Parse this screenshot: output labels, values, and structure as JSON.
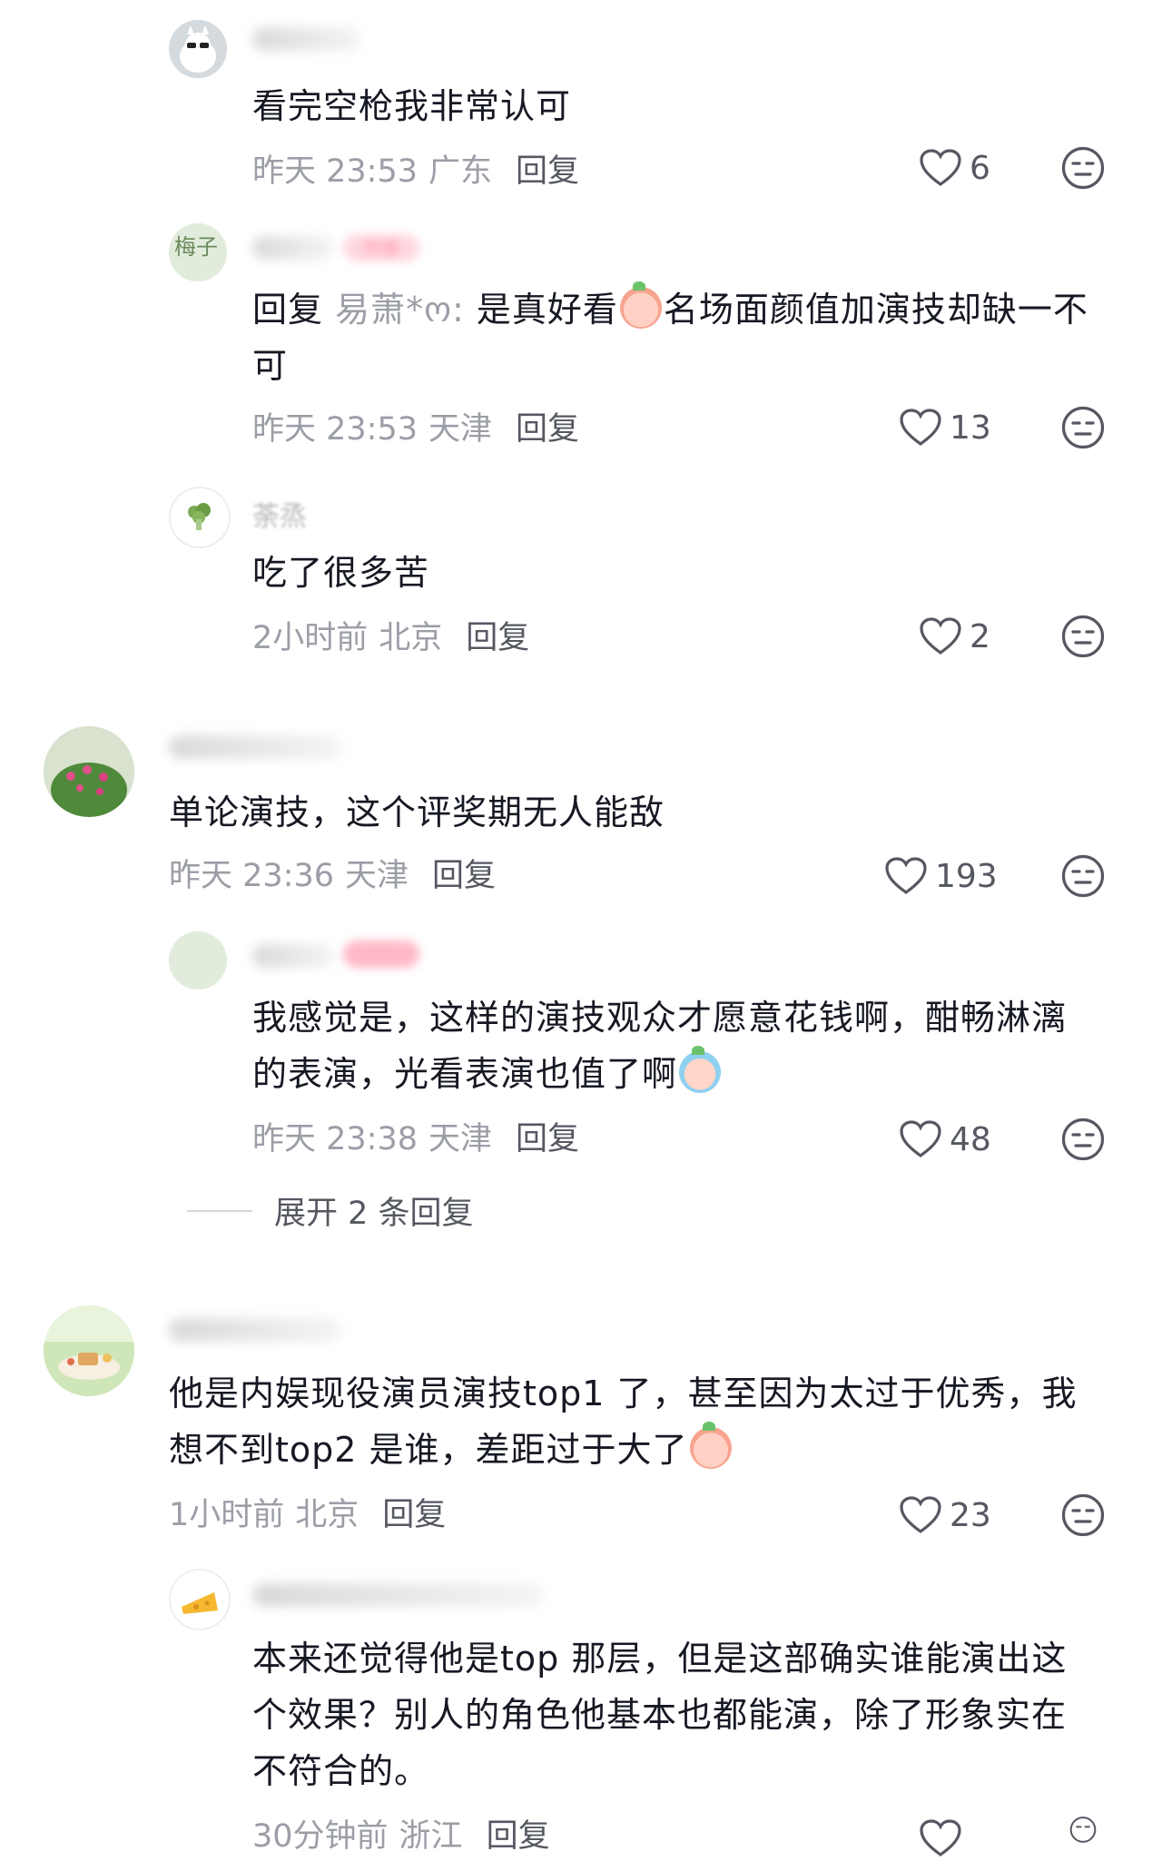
{
  "comments": [
    {
      "text": "看完空枪我非常认可",
      "time": "昨天 23:53",
      "location": "广东",
      "reply_label": "回复",
      "likes": "6"
    },
    {
      "reply_prefix": "回复",
      "reply_to": "易萧*ო:",
      "text_a": " 是真好看",
      "text_b": "名场面颜值加演技却缺一不",
      "text_c": "可",
      "time": "昨天 23:53",
      "location": "天津",
      "reply_label": "回复",
      "likes": "13",
      "tag": "作者",
      "avatar_text": "梅子"
    },
    {
      "name": "荼烝",
      "text": "吃了很多苦",
      "time": "2小时前",
      "location": "北京",
      "reply_label": "回复",
      "likes": "2"
    },
    {
      "text": "单论演技，这个评奖期无人能敌",
      "time": "昨天 23:36",
      "location": "天津",
      "reply_label": "回复",
      "likes": "193"
    },
    {
      "line1": "我感觉是，这样的演技观众才愿意花钱啊，酣畅淋漓",
      "line2": "的表演，光看表演也值了啊",
      "time": "昨天 23:38",
      "location": "天津",
      "reply_label": "回复",
      "likes": "48"
    },
    {
      "line1": "他是内娱现役演员演技top1 了，甚至因为太过于优秀，我",
      "line2": "想不到top2 是谁，差距过于大了",
      "time": "1小时前",
      "location": "北京",
      "reply_label": "回复",
      "likes": "23"
    },
    {
      "line1": "本来还觉得他是top 那层，但是这部确实谁能演出这",
      "line2": "个效果？别人的角色他基本也都能演，除了形象实在",
      "line3": "不符合的。",
      "time": "30分钟前",
      "location": "浙江",
      "reply_label": "回复"
    }
  ],
  "expand_replies": "展开 2 条回复",
  "colors": {
    "text": "#161823",
    "meta": "#9b9ea6",
    "icon": "#555861"
  }
}
